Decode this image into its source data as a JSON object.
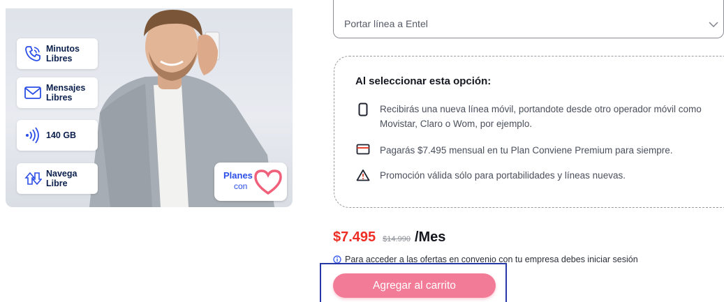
{
  "promo": {
    "features": [
      {
        "icon": "phone-call-icon",
        "label": "Minutos\nLibres"
      },
      {
        "icon": "envelope-icon",
        "label": "Mensajes\nLibres"
      },
      {
        "icon": "signal-waves-icon",
        "label": "140 GB"
      },
      {
        "icon": "navigate-arrows-icon",
        "label": "Navega\nLibre"
      }
    ],
    "badge": {
      "line1": "Planes",
      "line2": "con",
      "icon": "heart-icon",
      "color": "#2b4ee8",
      "heart_color": "#f0607a"
    }
  },
  "select": {
    "value": "Portar línea a Entel",
    "icon": "chevron-down-icon"
  },
  "info": {
    "title": "Al seleccionar esta opción:",
    "items": [
      {
        "icon": "mobile-icon",
        "text": "Recibirás una nueva línea móvil, portandote desde otro operador móvil como Movistar, Claro o Wom, por ejemplo."
      },
      {
        "icon": "credit-card-icon",
        "text": "Pagarás $7.495 mensual en tu Plan Conviene Premium para siempre."
      },
      {
        "icon": "warning-icon",
        "text": "Promoción válida sólo para portabilidades y líneas nuevas."
      }
    ]
  },
  "price": {
    "current": "$7.495",
    "old": "$14.990",
    "unit": "/Mes"
  },
  "notice": {
    "icon": "info-icon",
    "text": "Para acceder a las ofertas en convenio con tu empresa debes iniciar sesión"
  },
  "cart": {
    "label": "Agregar al carrito",
    "color": "#f27c97"
  },
  "colors": {
    "accent_red": "#ee2e24",
    "navy": "#0b1f4d",
    "highlight_border": "#2637a8"
  }
}
